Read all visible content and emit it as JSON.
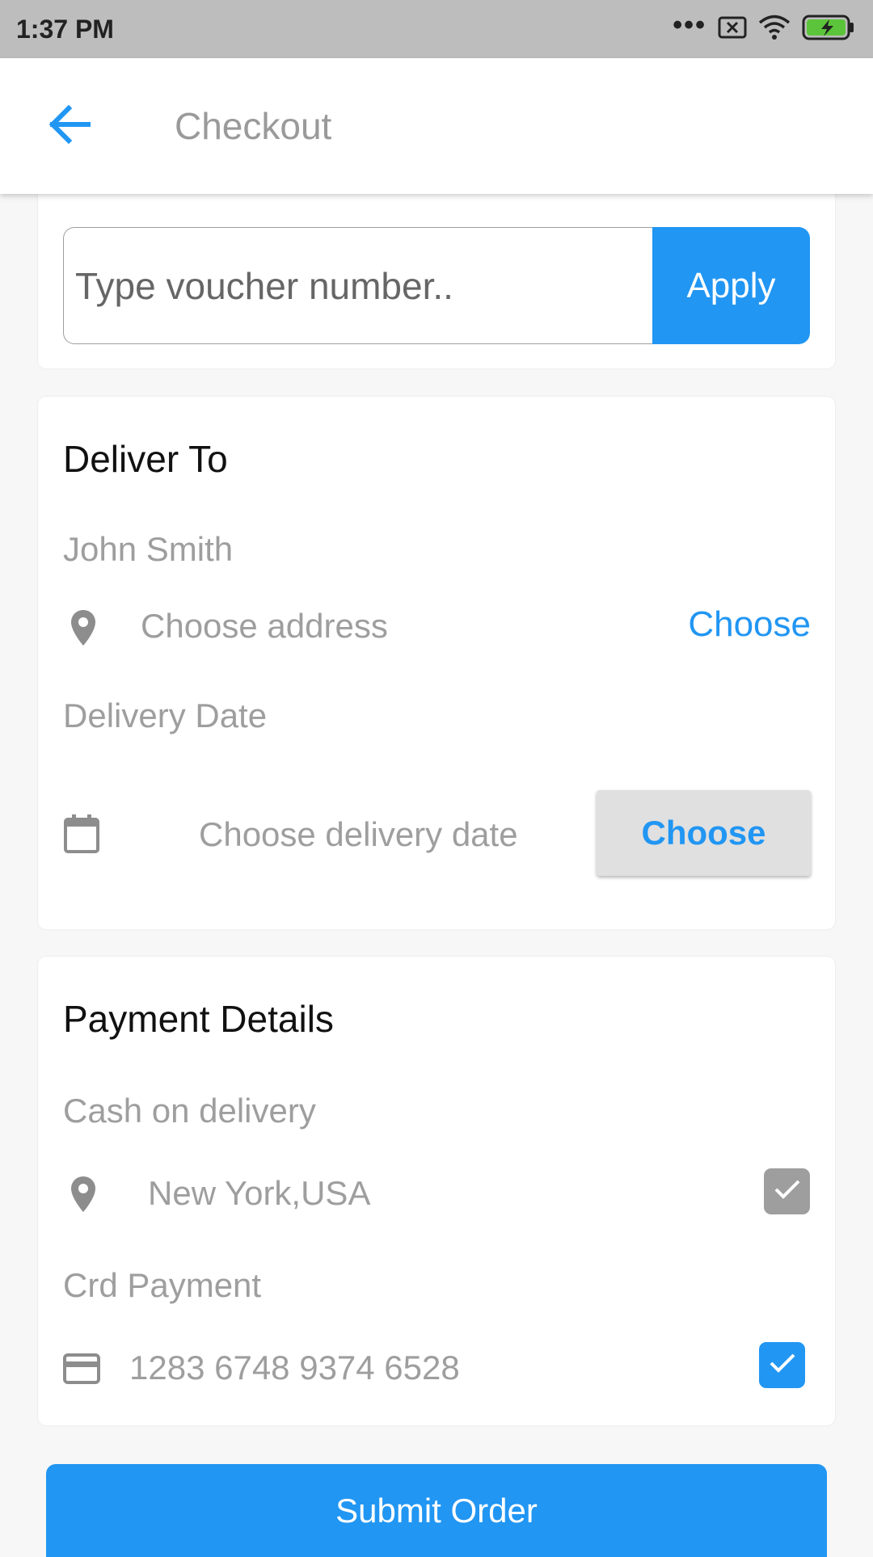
{
  "status_bar": {
    "time": "1:37 PM",
    "icons": [
      "more-dots-icon",
      "sim-off-icon",
      "wifi-icon",
      "battery-charging-icon"
    ]
  },
  "app_bar": {
    "title": "Checkout",
    "back_icon": "arrow-back-icon"
  },
  "voucher": {
    "placeholder": "Type voucher number..",
    "apply_label": "Apply"
  },
  "deliver_to": {
    "title": "Deliver To",
    "name": "John Smith",
    "address_placeholder": "Choose address",
    "address_choose_label": "Choose",
    "delivery_date_label": "Delivery Date",
    "date_placeholder": "Choose delivery date",
    "date_choose_label": "Choose"
  },
  "payment": {
    "title": "Payment Details",
    "cash_label": "Cash on delivery",
    "cash_location": "New York,USA",
    "cash_checked": true,
    "card_label": "Crd Payment",
    "card_number": "1283 6748 9374 6528",
    "card_checked": true
  },
  "submit_label": "Submit Order",
  "colors": {
    "accent": "#2196f3",
    "muted_text": "#9e9e9e",
    "checkbox_disabled": "#9e9e9e"
  }
}
